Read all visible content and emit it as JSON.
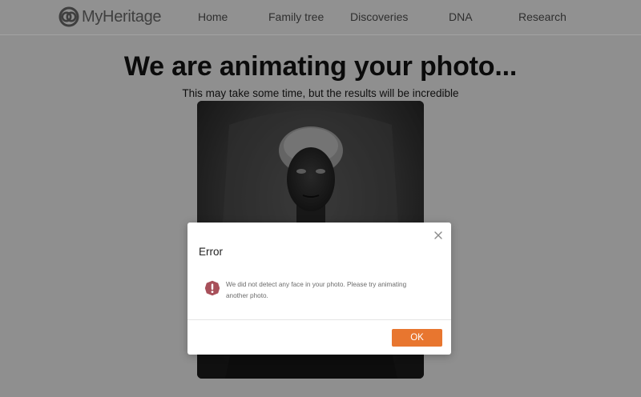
{
  "header": {
    "logo_text": "MyHeritage",
    "nav": [
      {
        "label": "Home"
      },
      {
        "label": "Family tree"
      },
      {
        "label": "Discoveries"
      },
      {
        "label": "DNA"
      },
      {
        "label": "Research"
      }
    ]
  },
  "main": {
    "title": "We are animating your photo...",
    "subtitle": "This may take some time, but the results will be incredible"
  },
  "dialog": {
    "title": "Error",
    "message": "We did not detect any face in your photo. Please try animating another photo.",
    "ok_label": "OK",
    "close_icon": "close-icon",
    "status_icon": "error-exclamation-icon"
  },
  "colors": {
    "overlay_background": "#8f8f8f",
    "accent": "#e8762f",
    "error_icon": "#a8505a"
  }
}
